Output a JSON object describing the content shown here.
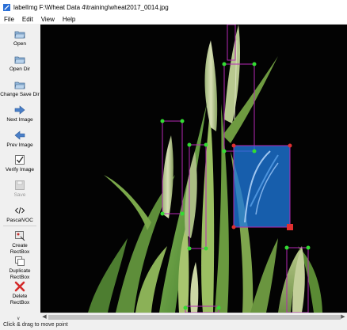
{
  "window": {
    "title": "labelImg F:\\Wheat Data 4\\training\\wheat2017_0014.jpg"
  },
  "menu": {
    "items": [
      "File",
      "Edit",
      "View",
      "Help"
    ]
  },
  "toolbar": {
    "open": "Open",
    "open_dir": "Open Dir",
    "change_save_dir": "Change Save Dir",
    "next_image": "Next Image",
    "prev_image": "Prev Image",
    "verify_image": "Verify Image",
    "save": "Save",
    "format": "PascalVOC",
    "create_rectbox": "Create\nRectBox",
    "duplicate_rectbox": "Duplicate\nRectBox",
    "delete_rectbox": "Delete\nRectBox"
  },
  "canvas": {
    "selected_box_color": "#1e78dc",
    "box_color": "#b428b4",
    "vertex_color": "#32dc32",
    "selected_vertex_color": "#e03030"
  },
  "status": {
    "text": "Click & drag to move point"
  }
}
